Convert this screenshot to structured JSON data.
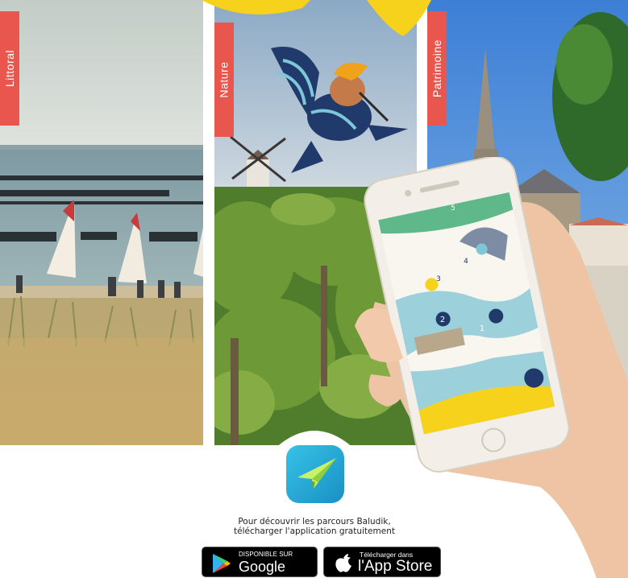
{
  "panels": {
    "littoral_label": "Littoral",
    "nature_label": "Nature",
    "patrimoine_label": "Patrimoine"
  },
  "app": {
    "icon": "paper-plane-icon",
    "description_line1": "Pour découvrir les parcours Baludik,",
    "description_line2": "télécharger l'application gratuitement"
  },
  "badges": {
    "google_small": "DISPONIBLE SUR",
    "google_big": "Google Play",
    "apple_small": "Télécharger dans",
    "apple_big": "l'App Store"
  },
  "phone_map": {
    "markers": [
      "1",
      "2",
      "3",
      "4",
      "5"
    ]
  },
  "colors": {
    "tab": "#e9564e",
    "app_icon": "#1bb0d8",
    "brand_yellow": "#f7d21c"
  }
}
